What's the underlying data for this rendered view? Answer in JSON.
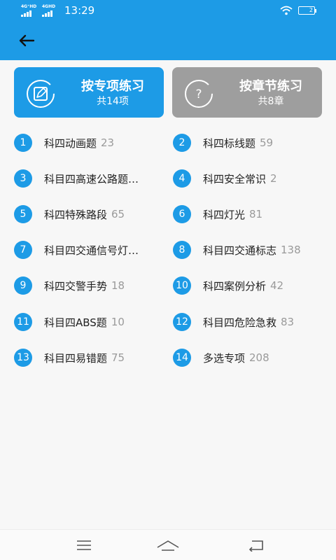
{
  "status_bar": {
    "signal1_label": "4G⁺HD",
    "signal2_label": "4GHD",
    "time": "13:29",
    "battery": "2"
  },
  "mode_cards": [
    {
      "title": "按专项练习",
      "subtitle": "共14项",
      "icon": "edit-icon"
    },
    {
      "title": "按章节练习",
      "subtitle": "共8章",
      "icon": "question-icon"
    }
  ],
  "topics": [
    {
      "num": "1",
      "name": "科四动画题",
      "count": "23"
    },
    {
      "num": "2",
      "name": "科四标线题",
      "count": "59"
    },
    {
      "num": "3",
      "name": "科目四高速公路题…",
      "count": ""
    },
    {
      "num": "4",
      "name": "科四安全常识",
      "count": "2"
    },
    {
      "num": "5",
      "name": "科四特殊路段",
      "count": "65"
    },
    {
      "num": "6",
      "name": "科四灯光",
      "count": "81"
    },
    {
      "num": "7",
      "name": "科目四交通信号灯…",
      "count": ""
    },
    {
      "num": "8",
      "name": "科目四交通标志",
      "count": "138"
    },
    {
      "num": "9",
      "name": "科四交警手势",
      "count": "18"
    },
    {
      "num": "10",
      "name": "科四案例分析",
      "count": "42"
    },
    {
      "num": "11",
      "name": "科目四ABS题",
      "count": "10"
    },
    {
      "num": "12",
      "name": "科目四危险急救",
      "count": "83"
    },
    {
      "num": "13",
      "name": "科目四易错题",
      "count": "75"
    },
    {
      "num": "14",
      "name": "多选专项",
      "count": "208"
    }
  ],
  "colors": {
    "primary": "#1d9be6",
    "inactive_card": "#9e9e9e",
    "count_text": "#9a9a9a"
  },
  "nav_icons": [
    "menu-icon",
    "home-icon",
    "back-icon"
  ]
}
